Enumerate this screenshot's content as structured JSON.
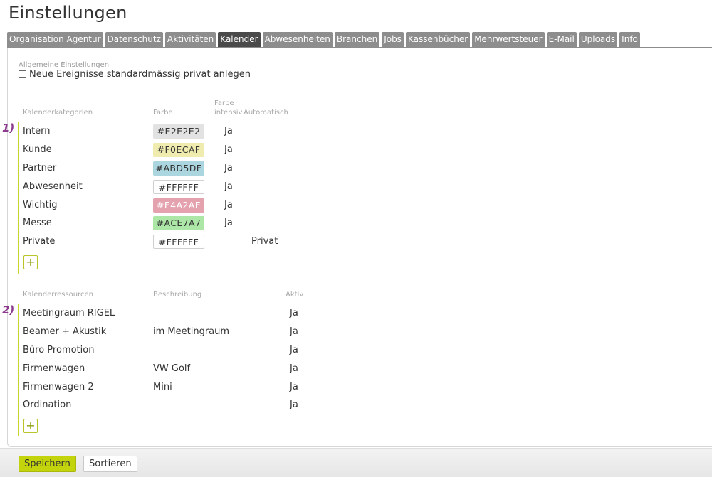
{
  "page": {
    "title": "Einstellungen"
  },
  "tabs": [
    {
      "label": "Organisation Agentur",
      "active": false
    },
    {
      "label": "Datenschutz",
      "active": false
    },
    {
      "label": "Aktivitäten",
      "active": false
    },
    {
      "label": "Kalender",
      "active": true
    },
    {
      "label": "Abwesenheiten",
      "active": false
    },
    {
      "label": "Branchen",
      "active": false
    },
    {
      "label": "Jobs",
      "active": false
    },
    {
      "label": "Kassenbücher",
      "active": false
    },
    {
      "label": "Mehrwertsteuer",
      "active": false
    },
    {
      "label": "E-Mail",
      "active": false
    },
    {
      "label": "Uploads",
      "active": false
    },
    {
      "label": "Info",
      "active": false
    }
  ],
  "general": {
    "caption": "Allgemeine Einstellungen",
    "private_checkbox_label": "Neue Ereignisse standardmässig privat anlegen",
    "private_checked": false
  },
  "categories": {
    "marker": "1)",
    "headers": {
      "name": "Kalenderkategorien",
      "color": "Farbe",
      "intensive_line1": "Farbe",
      "intensive_line2": "intensiv",
      "auto": "Automatisch"
    },
    "rows": [
      {
        "name": "Intern",
        "color": "#E2E2E2",
        "intensive": "Ja",
        "auto": ""
      },
      {
        "name": "Kunde",
        "color": "#F0ECAF",
        "intensive": "Ja",
        "auto": ""
      },
      {
        "name": "Partner",
        "color": "#ABD5DF",
        "intensive": "Ja",
        "auto": ""
      },
      {
        "name": "Abwesenheit",
        "color": "#FFFFFF",
        "intensive": "Ja",
        "auto": ""
      },
      {
        "name": "Wichtig",
        "color": "#E4A2AE",
        "intensive": "Ja",
        "auto": ""
      },
      {
        "name": "Messe",
        "color": "#ACE7A7",
        "intensive": "Ja",
        "auto": ""
      },
      {
        "name": "Private",
        "color": "#FFFFFF",
        "intensive": "",
        "auto": "Privat"
      }
    ],
    "add_label": "+"
  },
  "resources": {
    "marker": "2)",
    "headers": {
      "name": "Kalenderressourcen",
      "description": "Beschreibung",
      "active": "Aktiv"
    },
    "rows": [
      {
        "name": "Meetingraum RIGEL",
        "description": "",
        "active": "Ja"
      },
      {
        "name": "Beamer + Akustik",
        "description": "im Meetingraum",
        "active": "Ja"
      },
      {
        "name": "Büro Promotion",
        "description": "",
        "active": "Ja"
      },
      {
        "name": "Firmenwagen",
        "description": "VW Golf",
        "active": "Ja"
      },
      {
        "name": "Firmenwagen 2",
        "description": "Mini",
        "active": "Ja"
      },
      {
        "name": "Ordination",
        "description": "",
        "active": "Ja"
      }
    ],
    "add_label": "+"
  },
  "footer": {
    "save_label": "Speichern",
    "sort_label": "Sortieren"
  },
  "colors": {
    "accent": "#C3D30C",
    "marker": "#8B3A8E",
    "tab": "#8D8D8D",
    "tab_active": "#4A4A4A"
  }
}
